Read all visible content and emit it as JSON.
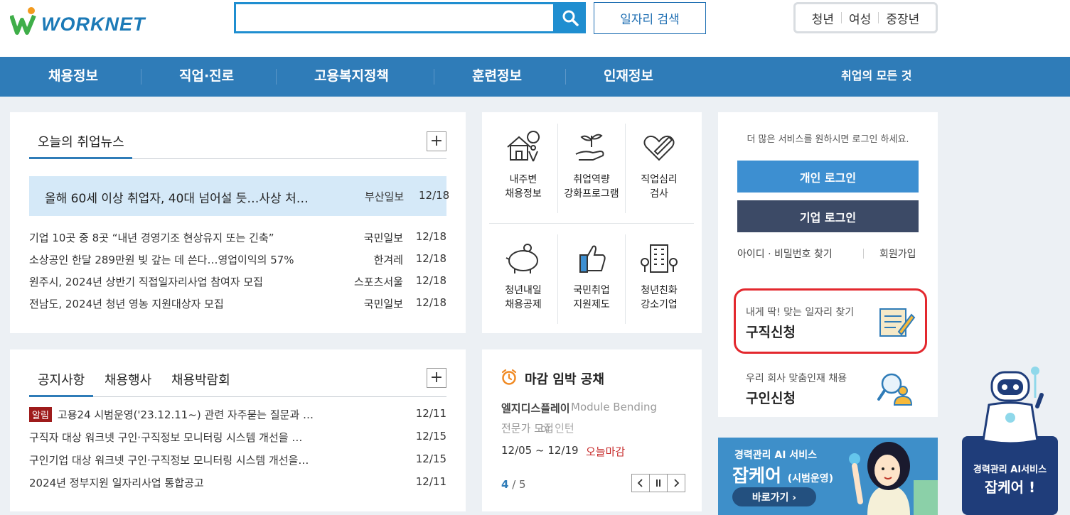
{
  "header": {
    "logo": "WORKNET",
    "search_placeholder": "",
    "search_button": "일자리 검색",
    "quick_links": [
      "청년",
      "여성",
      "중장년"
    ]
  },
  "nav": {
    "items": [
      "채용정보",
      "직업·진로",
      "고용복지정책",
      "훈련정보",
      "인재정보"
    ],
    "right": "취업의 모든 것"
  },
  "news": {
    "tab": "오늘의 취업뉴스",
    "headline": {
      "title": "올해 60세 이상 취업자, 40대 넘어설 듯…사상 처…",
      "source": "부산일보",
      "date": "12/18"
    },
    "items": [
      {
        "title": "기업 10곳 중 8곳 “내년 경영기조 현상유지 또는 긴축”",
        "source": "국민일보",
        "date": "12/18"
      },
      {
        "title": "소상공인 한달 289만원 빚 갚는 데 쓴다…영업이익의 57%",
        "source": "한겨레",
        "date": "12/18"
      },
      {
        "title": "원주시, 2024년 상반기 직접일자리사업 참여자 모집",
        "source": "스포츠서울",
        "date": "12/18"
      },
      {
        "title": "전남도, 2024년 청년 영농 지원대상자 모집",
        "source": "국민일보",
        "date": "12/18"
      }
    ]
  },
  "services": [
    {
      "line1": "내주변",
      "line2": "채용정보",
      "icon": "house-location-icon"
    },
    {
      "line1": "취업역량",
      "line2": "강화프로그램",
      "icon": "hand-sprout-icon"
    },
    {
      "line1": "직업심리",
      "line2": "검사",
      "icon": "heart-pen-icon"
    },
    {
      "line1": "청년내일",
      "line2": "채용공제",
      "icon": "piggy-bank-icon"
    },
    {
      "line1": "국민취업",
      "line2": "지원제도",
      "icon": "thumbs-up-icon"
    },
    {
      "line1": "청년친화",
      "line2": "강소기업",
      "icon": "building-icon"
    }
  ],
  "login": {
    "message": "더 많은 서비스를 원하시면 로그인 하세요.",
    "personal": "개인 로그인",
    "company": "기업 로그인",
    "find": "아이디 · 비밀번호 찾기",
    "join": "회원가입",
    "job_seek_sub": "내게 딱! 맞는 일자리 찾기",
    "job_seek": "구직신청",
    "job_offer_sub": "우리 회사 맞춤인재 채용",
    "job_offer": "구인신청"
  },
  "notice": {
    "tabs": [
      "공지사항",
      "채용행사",
      "채용박람회"
    ],
    "badge": "알림",
    "items": [
      {
        "title": "고용24 시범운영('23.12.11~) 관련 자주묻는 질문과 …",
        "date": "12/11"
      },
      {
        "title": "구직자 대상 워크넷 구인·구직정보 모니터링 시스템 개선을 …",
        "date": "12/15"
      },
      {
        "title": "구인기업 대상 워크넷 구인·구직정보 모니터링 시스템 개선을…",
        "date": "12/15"
      },
      {
        "title": "2024년 정부지원 일자리사업 통합공고",
        "date": "12/11"
      }
    ]
  },
  "deadline": {
    "title": "마감 임박 공채",
    "company": "엘지디스플레이",
    "ghost1": "Module Bending",
    "ghost2": "전문가 모집",
    "ghost3": "or 인턴",
    "date": "12/05 ~ 12/19",
    "today": "오늘마감",
    "page_current": "4",
    "page_total": "/ 5"
  },
  "banner": {
    "line1": "경력관리 AI 서비스",
    "line2": "잡케어",
    "line2_sub": "(시범운영)",
    "button": "바로가기 ›"
  },
  "robot": {
    "line1": "경력관리 AI서비스",
    "line2": "잡케어 !"
  },
  "colors": {
    "primary": "#2f7cb8",
    "search": "#1f8ed0",
    "company": "#3c4a66",
    "alert": "#c62828",
    "badge": "#9e1b1b"
  }
}
